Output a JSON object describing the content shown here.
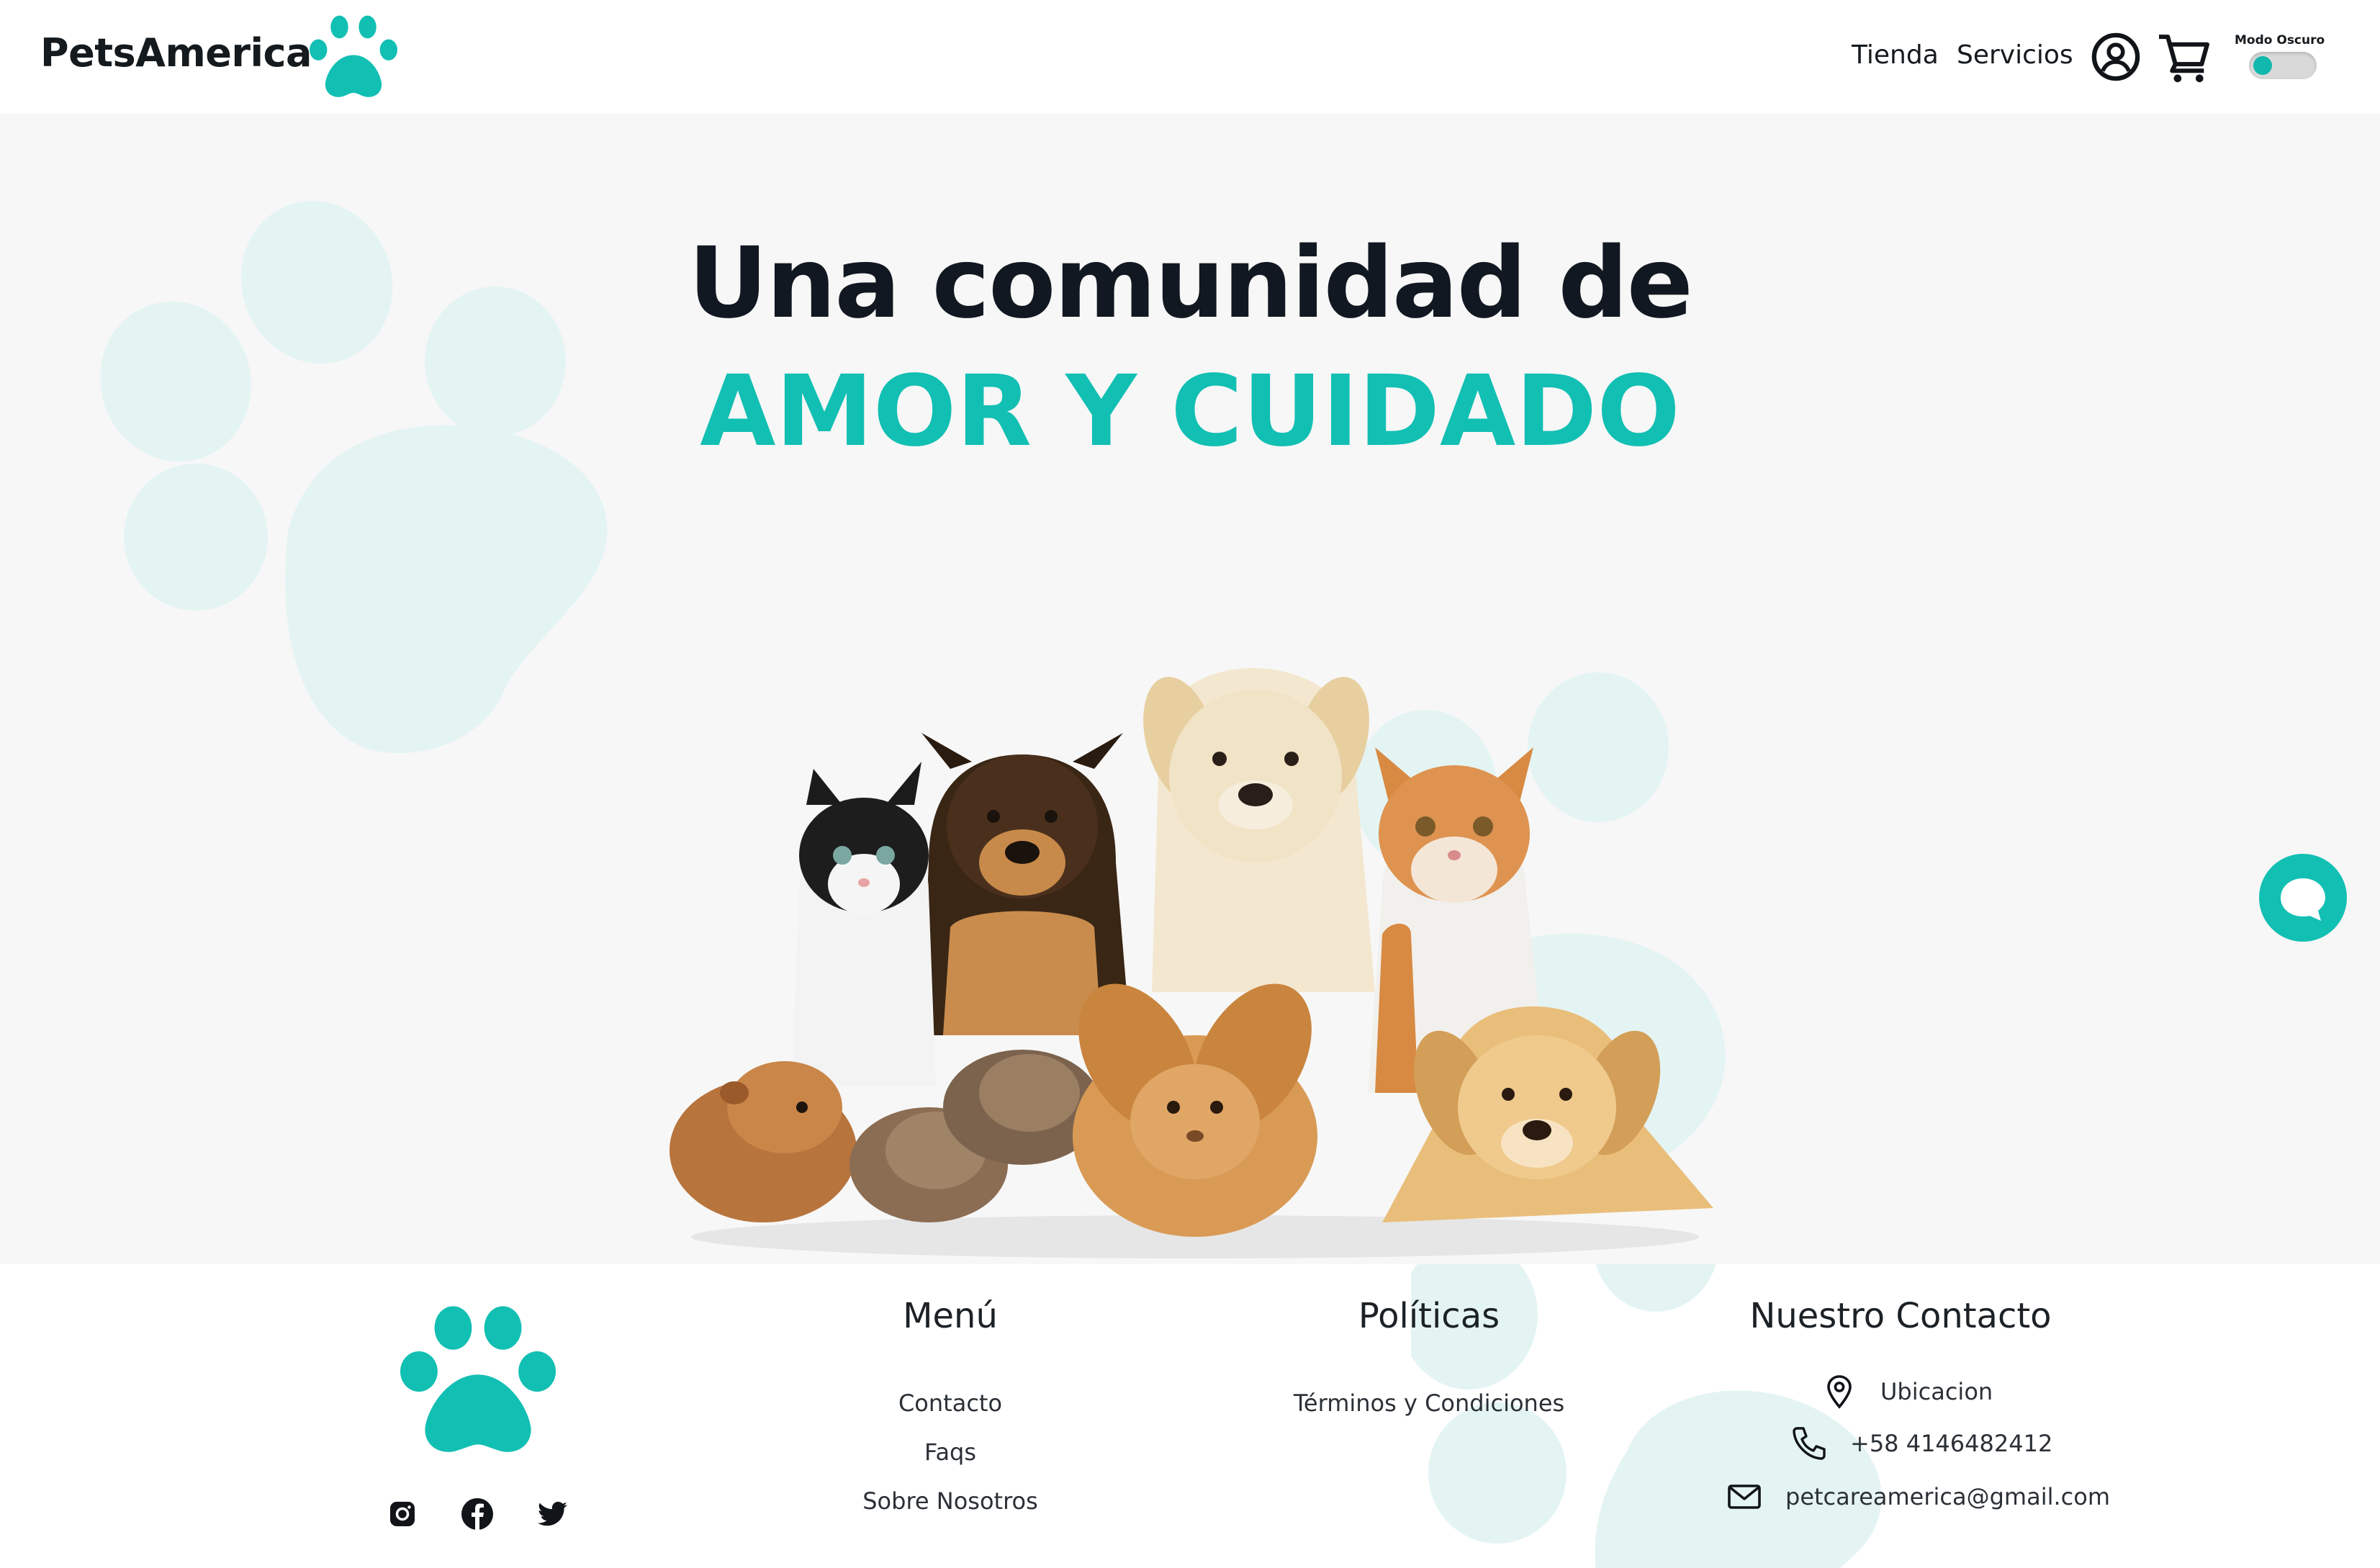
{
  "header": {
    "brand": "PetsAmerica",
    "nav": [
      "Tienda",
      "Servicios"
    ],
    "dark_mode_label": "Modo Oscuro",
    "dark_mode_on": false,
    "icons": [
      "paw-icon",
      "user-icon",
      "cart-icon"
    ]
  },
  "hero": {
    "title_line1": "Una comunidad de",
    "title_line2": "AMOR Y CUIDADO",
    "image": "group of pets: puppies, kittens, rabbit and guinea pig"
  },
  "chat": {
    "icon": "chat-bubble-icon"
  },
  "footer": {
    "menu_title": "Menú",
    "menu_items": [
      "Contacto",
      "Faqs",
      "Sobre Nosotros"
    ],
    "policies_title": "Políticas",
    "policies_items": [
      "Términos y Condiciones"
    ],
    "contact_title": "Nuestro Contacto",
    "contact": {
      "location": "Ubicacion",
      "phone": "+58 4146482412",
      "email": "petcareamerica@gmail.com"
    },
    "social": [
      "instagram-icon",
      "facebook-icon",
      "twitter-icon"
    ]
  },
  "colors": {
    "accent": "#12bfb3",
    "text_dark": "#121821",
    "hero_bg": "#f7f7f7",
    "decor_paw": "#e4f4f3"
  }
}
